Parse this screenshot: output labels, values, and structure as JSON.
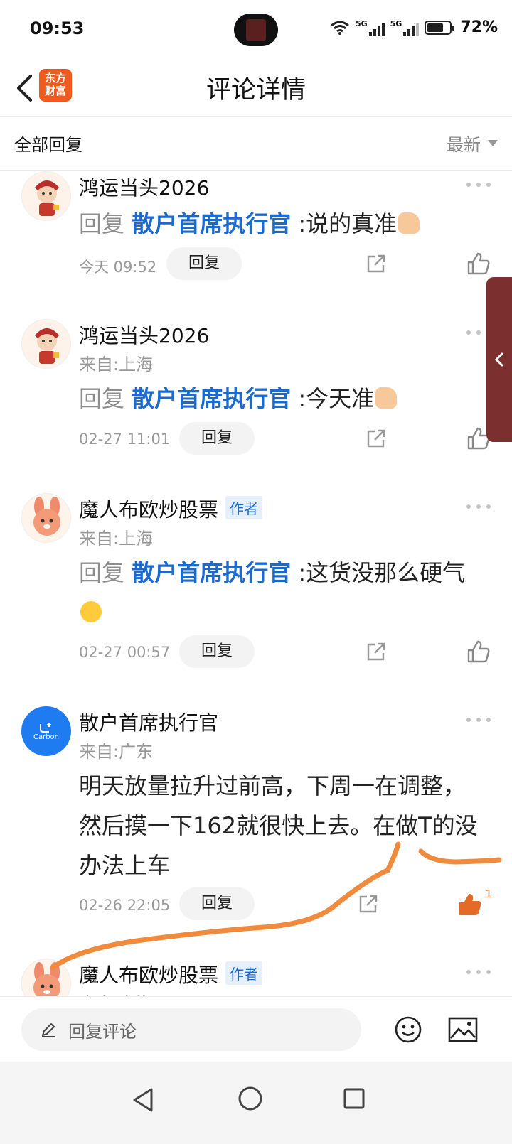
{
  "status_bar": {
    "time": "09:53",
    "network_1": "5G",
    "network_2": "5G",
    "battery": "72%"
  },
  "header": {
    "title": "评论详情",
    "app_logo_line1": "东方",
    "app_logo_line2": "财富",
    "logo_color": "#f05a1f"
  },
  "filter": {
    "label": "全部回复",
    "sort": "最新"
  },
  "comments": [
    {
      "user": "鸿运当头2026",
      "avatar": "mascot-avatar",
      "reply_prefix": "回复",
      "mention": "散户首席执行官",
      "separator": ":",
      "text": "说的真准",
      "emoji": "thumbs-up-emoji",
      "time": "今天 09:52",
      "reply_label": "回复"
    },
    {
      "user": "鸿运当头2026",
      "location": "来自:上海",
      "avatar": "mascot-avatar",
      "reply_prefix": "回复",
      "mention": "散户首席执行官",
      "separator": ":",
      "text": "今天准",
      "emoji": "thumbs-up-emoji",
      "time": "02-27 11:01",
      "reply_label": "回复"
    },
    {
      "user": "魔人布欧炒股票",
      "badge": "作者",
      "location": "来自:上海",
      "avatar": "rabbit-avatar",
      "reply_prefix": "回复",
      "mention": "散户首席执行官",
      "separator": ":",
      "text": "这货没那么硬气",
      "emoji": "laughing-emoji",
      "time": "02-27 00:57",
      "reply_label": "回复"
    },
    {
      "user": "散户首席执行官",
      "location": "来自:广东",
      "avatar": "brand-avatar",
      "avatar_text": "Carbon",
      "text": "明天放量拉升过前高，下周一在调整，然后摸一下162就很快上去。在做T的没办法上车",
      "time": "02-26 22:05",
      "reply_label": "回复",
      "likes": "1",
      "liked": true,
      "like_color": "#e46a28"
    },
    {
      "user": "魔人布欧炒股票",
      "badge": "作者",
      "location": "来自:上海",
      "avatar": "rabbit-avatar"
    }
  ],
  "input": {
    "placeholder": "回复评论"
  },
  "colors": {
    "mention": "#1a6ad0",
    "annotation_stroke": "#f08a3c",
    "side_tab": "#7c2f2f"
  }
}
